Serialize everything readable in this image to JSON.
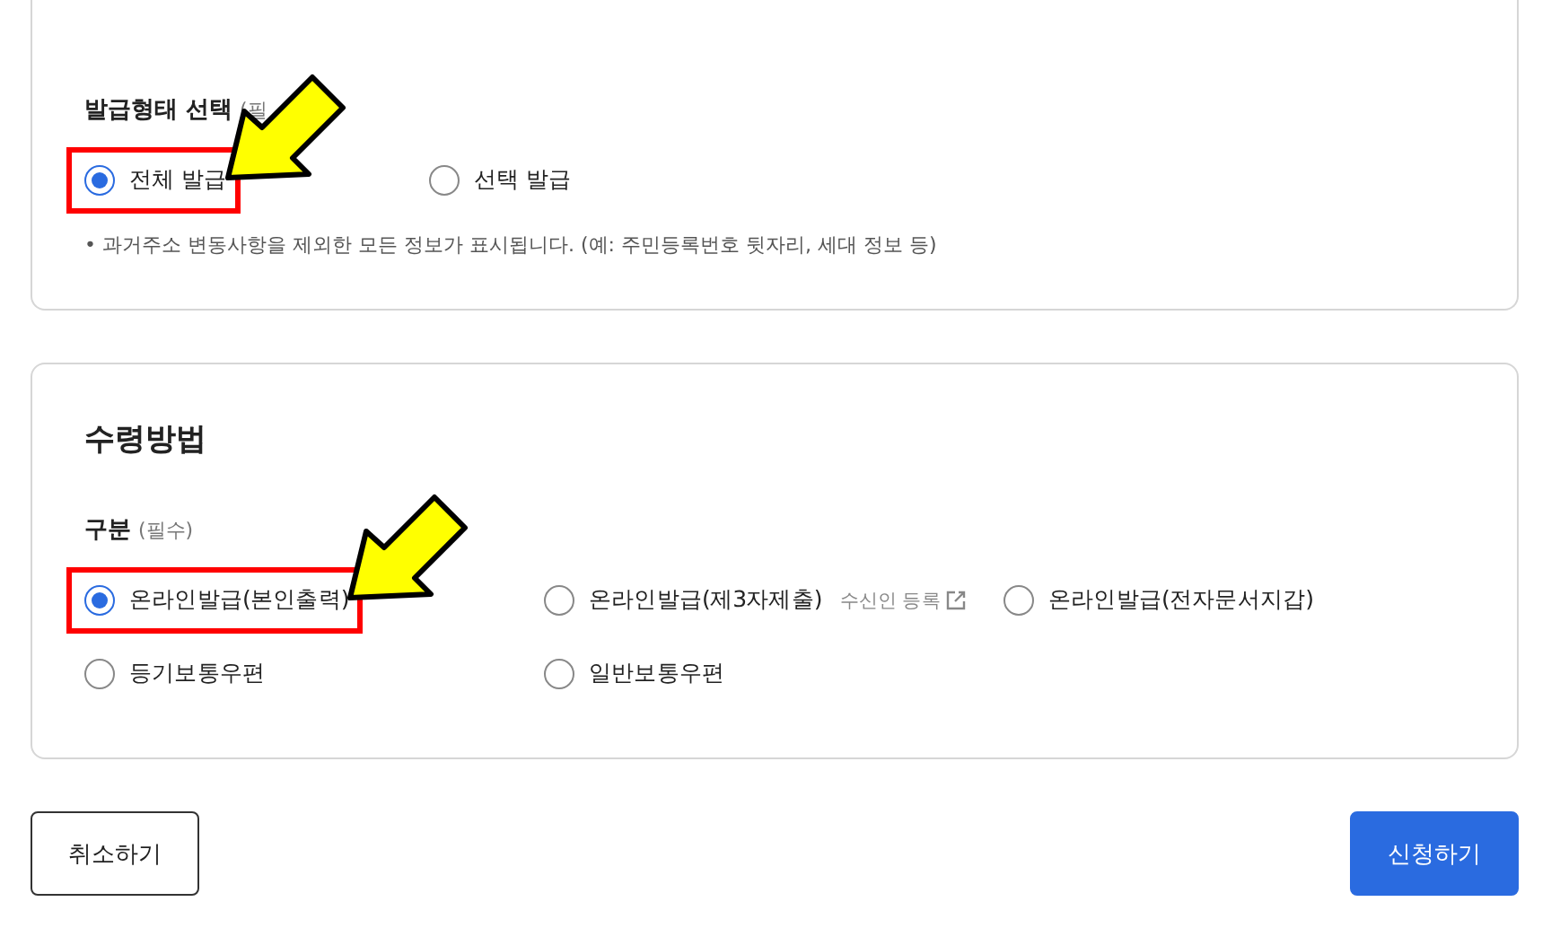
{
  "issue_type": {
    "title": "발급형태 선택",
    "required": "(필",
    "options": [
      {
        "label": "전체 발급",
        "selected": true,
        "highlighted": true
      },
      {
        "label": "선택 발급",
        "selected": false,
        "highlighted": false
      }
    ],
    "note": "• 과거주소 변동사항을 제외한 모든 정보가 표시됩니다. (예: 주민등록번호 뒷자리, 세대 정보 등)"
  },
  "receipt": {
    "title": "수령방법",
    "field_label": "구분",
    "required": "(필수)",
    "options": [
      {
        "label": "온라인발급(본인출력)",
        "selected": true,
        "highlighted": true
      },
      {
        "label": "온라인발급(제3자제출)",
        "selected": false,
        "highlighted": false,
        "link": "수신인 등록"
      },
      {
        "label": "온라인발급(전자문서지갑)",
        "selected": false,
        "highlighted": false
      },
      {
        "label": "등기보통우편",
        "selected": false,
        "highlighted": false
      },
      {
        "label": "일반보통우편",
        "selected": false,
        "highlighted": false
      }
    ]
  },
  "buttons": {
    "cancel": "취소하기",
    "submit": "신청하기"
  }
}
